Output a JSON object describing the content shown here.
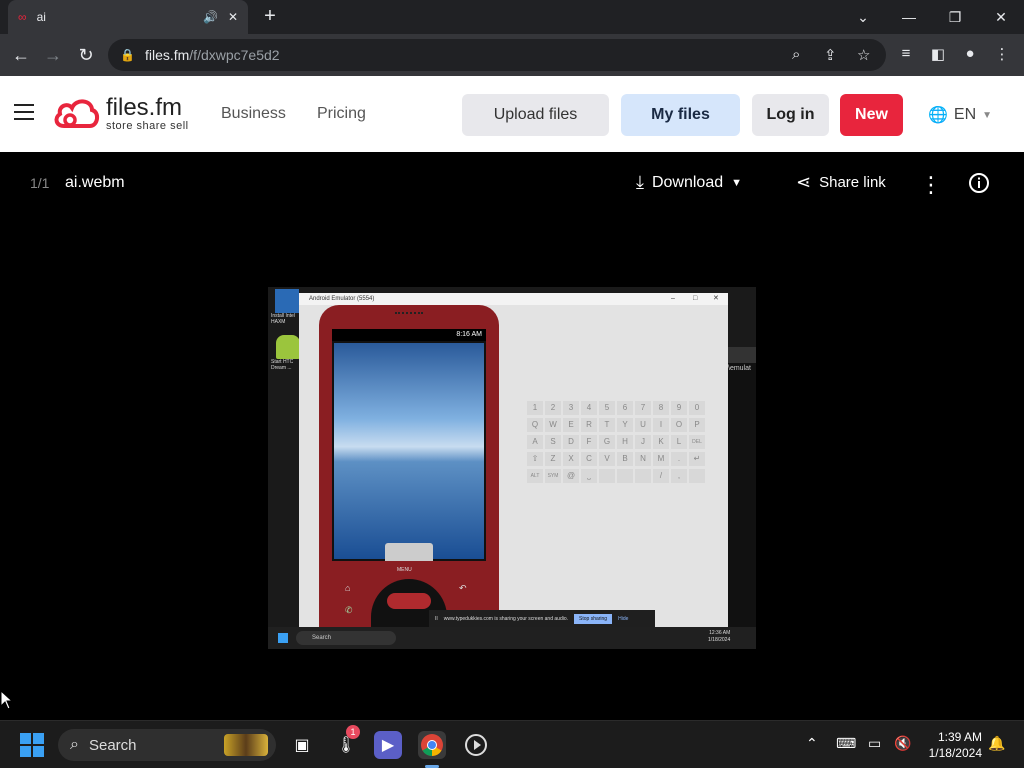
{
  "browser": {
    "tab_title": "ai",
    "url_host": "files.fm",
    "url_path": "/f/dxwpc7e5d2"
  },
  "site": {
    "logo_name": "files.fm",
    "logo_tagline": "store share sell",
    "nav": [
      "Business",
      "Pricing"
    ],
    "buttons": {
      "upload": "Upload files",
      "my_files": "My files",
      "login": "Log in",
      "new": "New"
    },
    "language": "EN",
    "brand_color": "#e8253d"
  },
  "viewer": {
    "counter": "1/1",
    "file_name": "ai.webm",
    "download_label": "Download",
    "share_label": "Share link"
  },
  "video": {
    "emulator_title": "Android Emulator (5554)",
    "phone_time": "8:16 AM",
    "phone_menu": "MENU",
    "desk_icon_1": "Install Intel HAXM",
    "desk_icon_2": "Start HTC Dream ...",
    "side_text": "\\emulat",
    "share_notice": "www.typedukkies.com is sharing your screen and audio.",
    "stop_sharing": "Stop sharing",
    "hide": "Hide",
    "mini_search": "Search",
    "mini_time": "12:36 AM",
    "mini_date": "1/18/2024",
    "keyboard_rows": [
      [
        "1",
        "2",
        "3",
        "4",
        "5",
        "6",
        "7",
        "8",
        "9",
        "0"
      ],
      [
        "Q",
        "W",
        "E",
        "R",
        "T",
        "Y",
        "U",
        "I",
        "O",
        "P"
      ],
      [
        "A",
        "S",
        "D",
        "F",
        "G",
        "H",
        "J",
        "K",
        "L",
        "DEL"
      ],
      [
        "⇧",
        "Z",
        "X",
        "C",
        "V",
        "B",
        "N",
        "M",
        ".",
        "↵"
      ],
      [
        "ALT",
        "SYM",
        "@",
        "⎵",
        "",
        "",
        "",
        "/",
        ",",
        ""
      ]
    ]
  },
  "taskbar": {
    "search_label": "Search",
    "time": "1:39 AM",
    "date": "1/18/2024",
    "badge_count": "1"
  }
}
